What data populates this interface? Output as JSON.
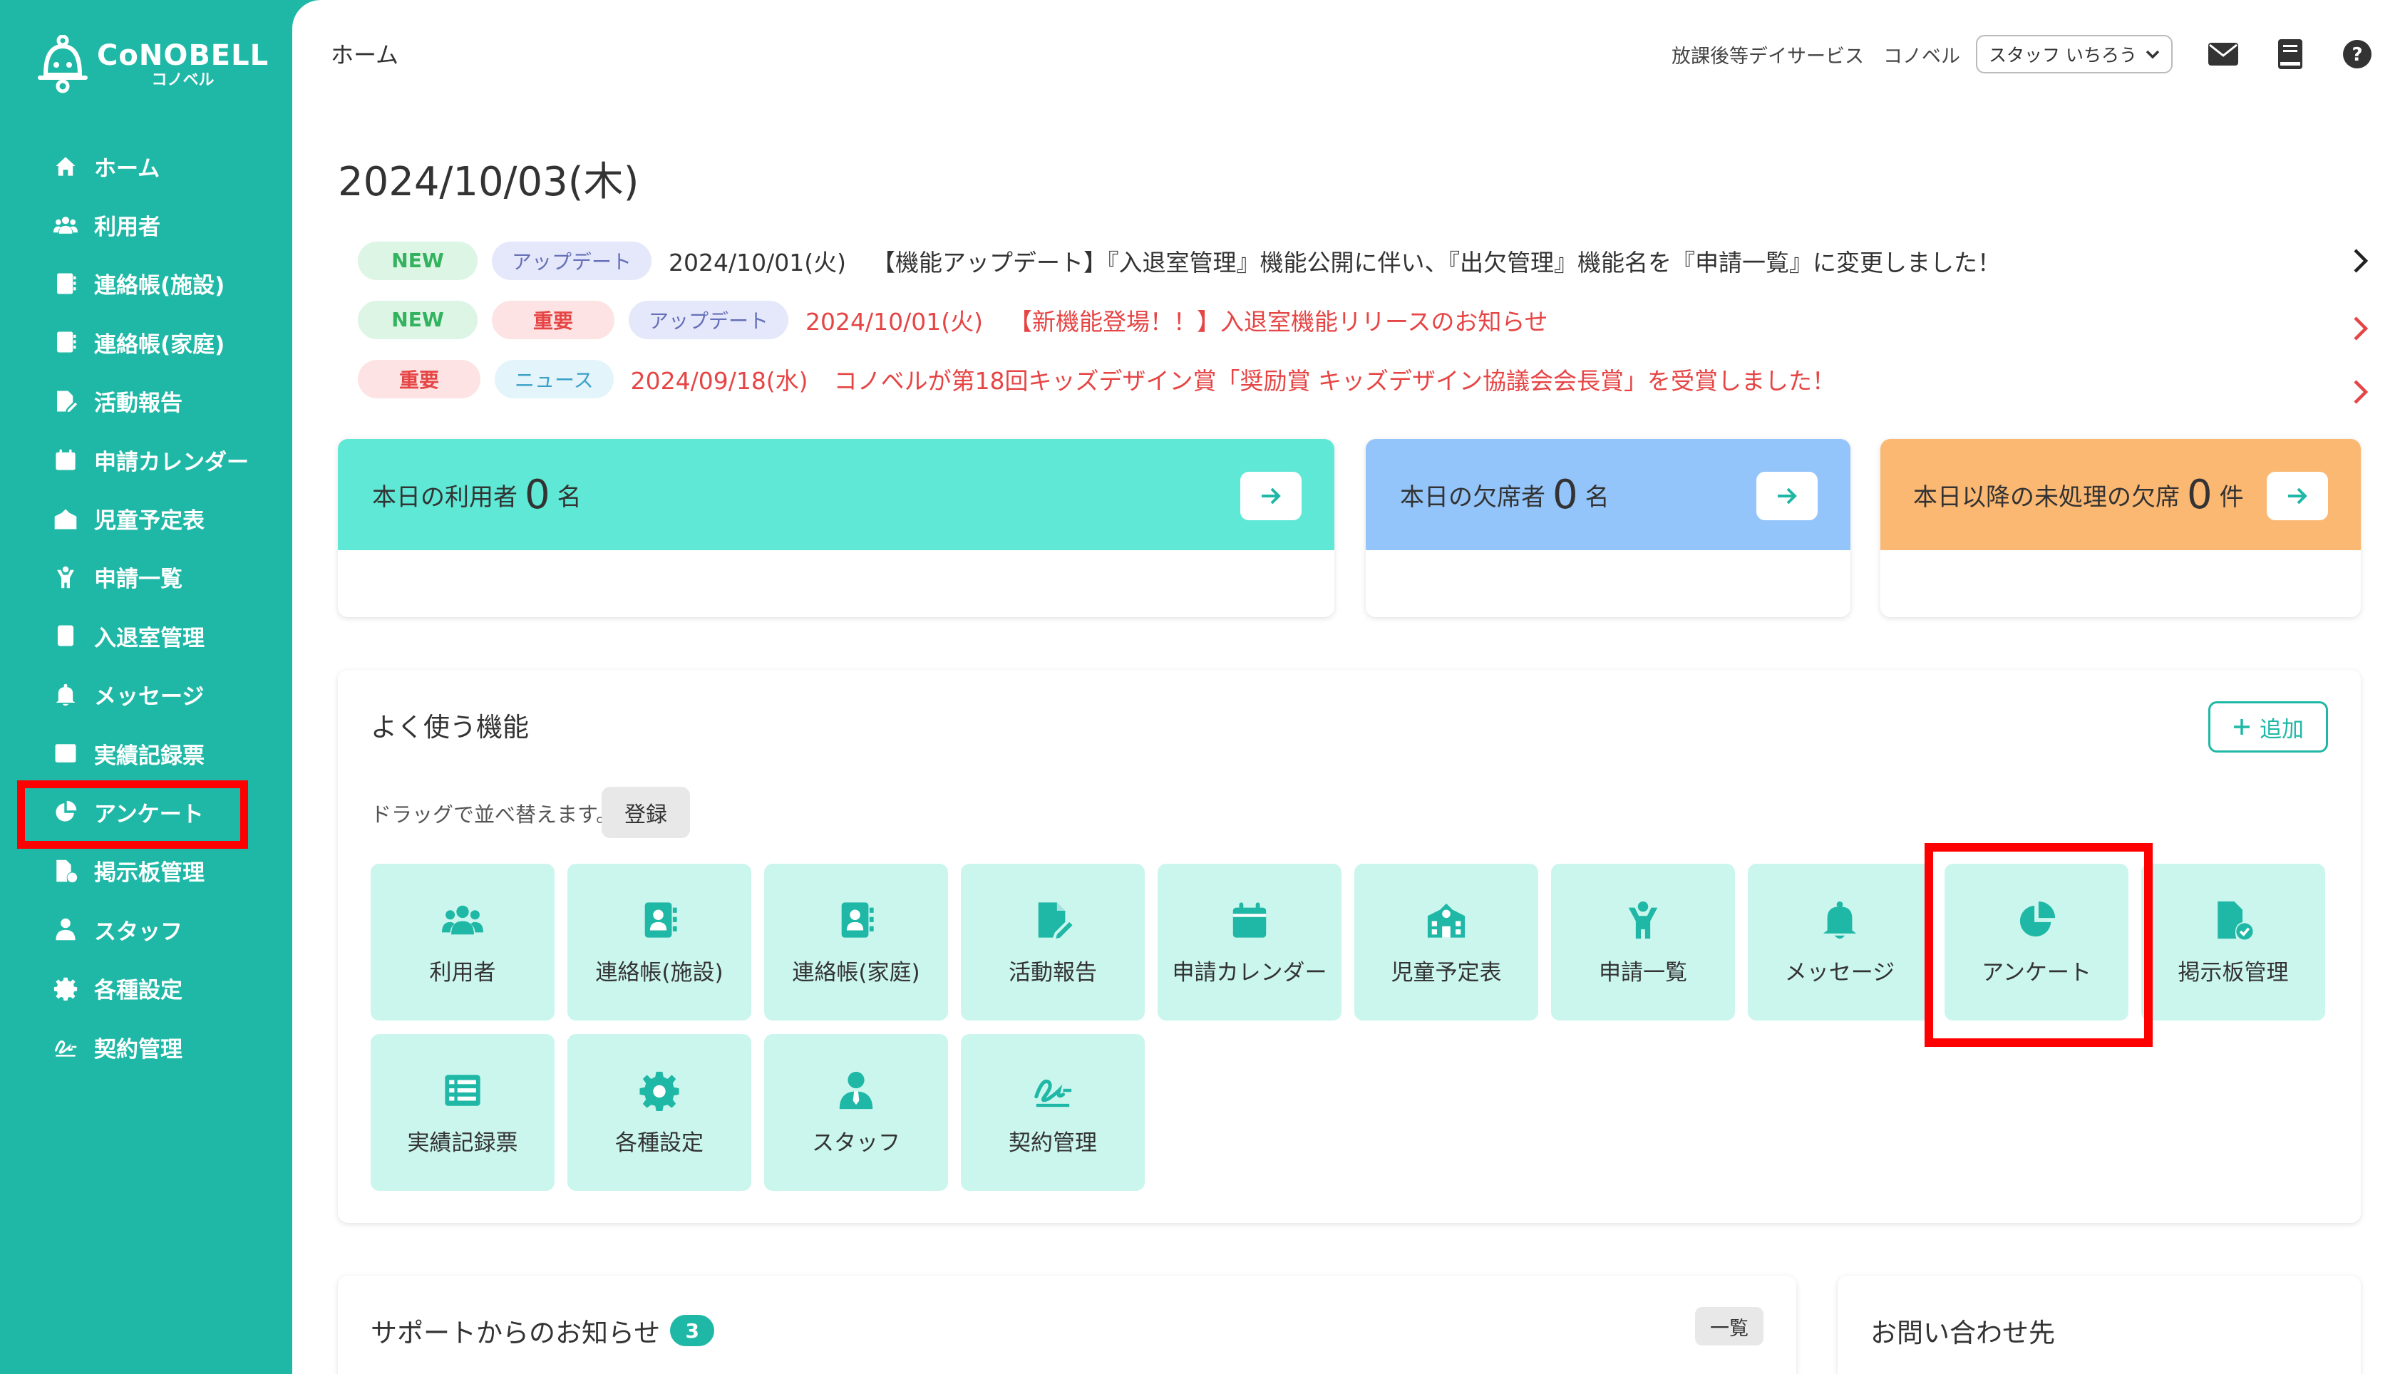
{
  "app": {
    "logo_name": "CoNOBELL",
    "logo_sub": "コノベル"
  },
  "sidebar": {
    "items": [
      {
        "label": "ホーム",
        "icon": "home-icon"
      },
      {
        "label": "利用者",
        "icon": "users-icon"
      },
      {
        "label": "連絡帳(施設)",
        "icon": "contact-book-icon"
      },
      {
        "label": "連絡帳(家庭)",
        "icon": "contact-book-icon"
      },
      {
        "label": "活動報告",
        "icon": "file-edit-icon"
      },
      {
        "label": "申請カレンダー",
        "icon": "calendar-icon"
      },
      {
        "label": "児童予定表",
        "icon": "school-icon"
      },
      {
        "label": "申請一覧",
        "icon": "child-icon"
      },
      {
        "label": "入退室管理",
        "icon": "tablet-icon"
      },
      {
        "label": "メッセージ",
        "icon": "bell-icon"
      },
      {
        "label": "実績記録票",
        "icon": "list-table-icon"
      },
      {
        "label": "アンケート",
        "icon": "pie-chart-icon"
      },
      {
        "label": "掲示板管理",
        "icon": "file-check-icon"
      },
      {
        "label": "スタッフ",
        "icon": "staff-icon"
      },
      {
        "label": "各種設定",
        "icon": "gear-icon"
      },
      {
        "label": "契約管理",
        "icon": "signature-icon"
      }
    ]
  },
  "header": {
    "breadcrumb": "ホーム",
    "facility": "放課後等デイサービス　コノベル",
    "staff_select": "スタッフ いちろう"
  },
  "main": {
    "date_title": "2024/10/03(木)",
    "news": [
      {
        "tags": [
          {
            "text": "NEW",
            "kind": "new"
          },
          {
            "text": "アップデート",
            "kind": "update"
          }
        ],
        "date": "2024/10/01(火)",
        "text": "【機能アップデート】『入退室管理』機能公開に伴い、『出欠管理』機能名を『申請一覧』に変更しました！",
        "color": "#333333"
      },
      {
        "tags": [
          {
            "text": "NEW",
            "kind": "new"
          },
          {
            "text": "重要",
            "kind": "important"
          },
          {
            "text": "アップデート",
            "kind": "update"
          }
        ],
        "date": "2024/10/01(火)",
        "text": "【新機能登場！！】入退室機能リリースのお知らせ",
        "color": "#e64545"
      },
      {
        "tags": [
          {
            "text": "重要",
            "kind": "important"
          },
          {
            "text": "ニュース",
            "kind": "news"
          }
        ],
        "date": "2024/09/18(水)",
        "text": "コノベルが第18回キッズデザイン賞「奨励賞 キッズデザイン協議会会長賞」を受賞しました！",
        "color": "#e64545"
      }
    ],
    "cards": [
      {
        "label": "本日の利用者",
        "value": "0",
        "unit": "名",
        "color": "#5ee8d5"
      },
      {
        "label": "本日の欠席者",
        "value": "0",
        "unit": "名",
        "color": "#93c4fa"
      },
      {
        "label": "本日以降の未処理の欠席",
        "value": "0",
        "unit": "件",
        "color": "#fbb872"
      }
    ],
    "favorites": {
      "title": "よく使う機能",
      "add_label": "追加",
      "drag_hint": "ドラッグで並べ替えます。",
      "register_label": "登録",
      "tiles": [
        {
          "label": "利用者",
          "icon": "users-icon"
        },
        {
          "label": "連絡帳(施設)",
          "icon": "contact-book-icon"
        },
        {
          "label": "連絡帳(家庭)",
          "icon": "contact-book-icon"
        },
        {
          "label": "活動報告",
          "icon": "file-edit-icon"
        },
        {
          "label": "申請カレンダー",
          "icon": "calendar-icon"
        },
        {
          "label": "児童予定表",
          "icon": "school-icon"
        },
        {
          "label": "申請一覧",
          "icon": "child-icon"
        },
        {
          "label": "メッセージ",
          "icon": "bell-icon"
        },
        {
          "label": "アンケート",
          "icon": "pie-chart-icon"
        },
        {
          "label": "掲示板管理",
          "icon": "file-check-icon"
        },
        {
          "label": "実績記録票",
          "icon": "list-table-icon"
        },
        {
          "label": "各種設定",
          "icon": "gear-icon"
        },
        {
          "label": "スタッフ",
          "icon": "staff-icon"
        },
        {
          "label": "契約管理",
          "icon": "signature-icon"
        }
      ]
    },
    "support": {
      "title": "サポートからのお知らせ",
      "count": "3",
      "list_label": "一覧"
    },
    "contact": {
      "title": "お問い合わせ先"
    }
  },
  "colors": {
    "brand": "#1fb8a6",
    "highlight": "#ff0000",
    "tile_bg": "#cbf6ee",
    "alert": "#e64545"
  }
}
